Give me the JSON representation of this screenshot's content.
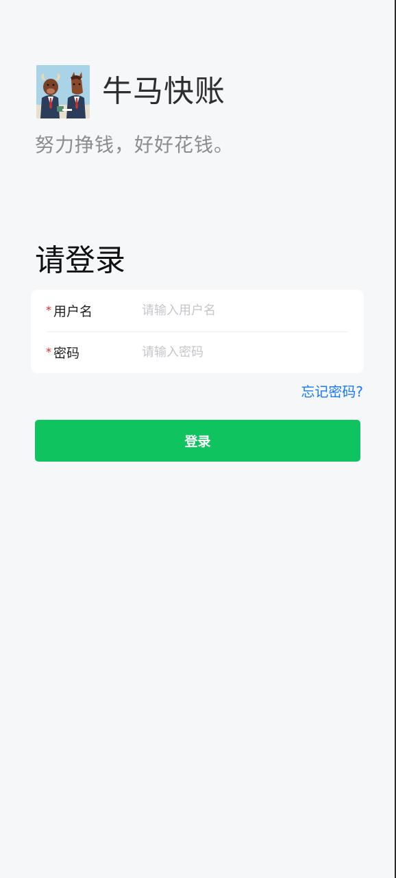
{
  "brand": {
    "app_name": "牛马快账",
    "slogan": "努力挣钱，好好花钱。",
    "logo_icon": "bull-and-horse-logo-icon"
  },
  "login": {
    "title": "请登录",
    "required_mark": "*",
    "username": {
      "label": "用户名",
      "placeholder": "请输入用户名",
      "value": ""
    },
    "password": {
      "label": "密码",
      "placeholder": "请输入密码",
      "value": ""
    },
    "forgot_password": "忘记密码?",
    "submit_label": "登录"
  },
  "colors": {
    "background": "#f6f7f9",
    "primary_button": "#0fc35f",
    "link": "#1677ff",
    "required": "#e02424"
  }
}
